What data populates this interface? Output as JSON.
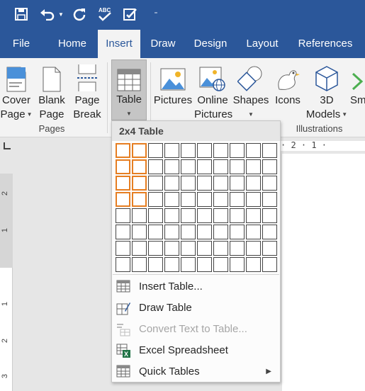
{
  "qat": {
    "icons": [
      "save-icon",
      "undo-icon",
      "undo-dropdown-icon",
      "redo-icon",
      "spelling-icon",
      "touch-mode-icon",
      "customize-qat-icon"
    ]
  },
  "tabs": [
    "File",
    "Home",
    "Insert",
    "Draw",
    "Design",
    "Layout",
    "References"
  ],
  "ribbon": {
    "pages_group": {
      "label": "Pages",
      "cover_page": [
        "Cover",
        "Page"
      ],
      "blank_page": [
        "Blank",
        "Page"
      ],
      "page_break": [
        "Page",
        "Break"
      ]
    },
    "table_button": "Table",
    "illustrations_group": {
      "label": "Illustrations",
      "pictures": "Pictures",
      "online_pictures": [
        "Online",
        "Pictures"
      ],
      "shapes": "Shapes",
      "icons": "Icons",
      "models_3d": [
        "3D",
        "Models"
      ],
      "smartart_partial": "Sm"
    }
  },
  "ruler": {
    "h_text": "· 2 · 1 ·",
    "v_numbers": [
      "2",
      "1",
      "1",
      "2",
      "3"
    ]
  },
  "dropdown": {
    "header": "2x4 Table",
    "grid": {
      "cols": 10,
      "rows": 8,
      "selected_cols": 2,
      "selected_rows": 4
    },
    "items": [
      {
        "label": "Insert Table...",
        "icon": "insert-table-icon",
        "enabled": true
      },
      {
        "label": "Draw Table",
        "icon": "draw-table-icon",
        "enabled": true
      },
      {
        "label": "Convert Text to Table...",
        "icon": "convert-text-icon",
        "enabled": false
      },
      {
        "label": "Excel Spreadsheet",
        "icon": "excel-icon",
        "enabled": true
      },
      {
        "label": "Quick Tables",
        "icon": "quick-tables-icon",
        "enabled": true,
        "submenu": true
      }
    ]
  },
  "colors": {
    "accent": "#2b579a",
    "selection": "#e67e22",
    "ribbon_bg": "#f3f3f3"
  }
}
